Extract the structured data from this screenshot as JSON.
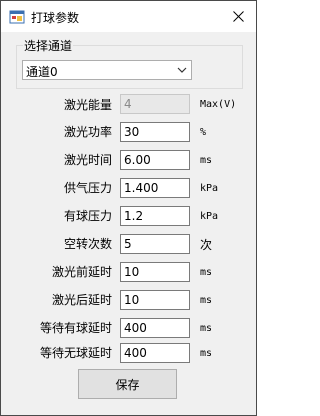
{
  "window": {
    "title": "打球参数"
  },
  "channel_group": {
    "label": "选择通道",
    "selected": "通道0"
  },
  "params": [
    {
      "label": "激光能量",
      "value": "4",
      "unit": "Max(V)",
      "disabled": true
    },
    {
      "label": "激光功率",
      "value": "30",
      "unit": "%",
      "disabled": false
    },
    {
      "label": "激光时间",
      "value": "6.00",
      "unit": "ms",
      "disabled": false
    },
    {
      "label": "供气压力",
      "value": "1.400",
      "unit": "kPa",
      "disabled": false
    },
    {
      "label": "有球压力",
      "value": "1.2",
      "unit": "kPa",
      "disabled": false
    },
    {
      "label": "空转次数",
      "value": "5",
      "unit": "次",
      "disabled": false
    },
    {
      "label": "激光前延时",
      "value": "10",
      "unit": "ms",
      "disabled": false
    },
    {
      "label": "激光后延时",
      "value": "10",
      "unit": "ms",
      "disabled": false
    },
    {
      "label": "等待有球延时",
      "value": "400",
      "unit": "ms",
      "disabled": false
    },
    {
      "label": "等待无球延时",
      "value": "400",
      "unit": "ms",
      "disabled": false
    }
  ],
  "buttons": {
    "save": "保存"
  },
  "icons": {
    "app": "app-window-icon",
    "close": "close-icon",
    "dropdown": "chevron-down-icon"
  },
  "colors": {
    "titlebar": "#ffffff",
    "body": "#f0f0f0",
    "button": "#e1e1e1"
  }
}
